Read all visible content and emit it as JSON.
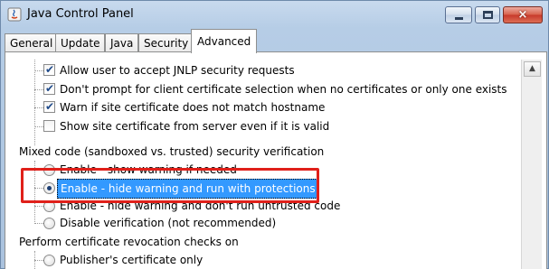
{
  "window": {
    "title": "Java Control Panel",
    "close_glyph": "×"
  },
  "tabs": [
    {
      "label": "General"
    },
    {
      "label": "Update"
    },
    {
      "label": "Java"
    },
    {
      "label": "Security"
    },
    {
      "label": "Advanced"
    }
  ],
  "checkbox_items": [
    {
      "label": "Allow user to accept JNLP security requests",
      "checked": true
    },
    {
      "label": "Don't prompt for client certificate selection when no certificates or only one exists",
      "checked": true
    },
    {
      "label": "Warn if site certificate does not match hostname",
      "checked": true
    },
    {
      "label": "Show site certificate from server even if it is valid",
      "checked": false
    }
  ],
  "mixed_code": {
    "heading": "Mixed code (sandboxed vs. trusted) security verification",
    "options": [
      {
        "label": "Enable - show warning if needed",
        "selected": false
      },
      {
        "label": "Enable - hide warning and run with protections",
        "selected": true
      },
      {
        "label": "Enable - hide warning and don't run untrusted code",
        "selected": false
      },
      {
        "label": "Disable verification (not recommended)",
        "selected": false
      }
    ]
  },
  "revocation": {
    "heading": "Perform certificate revocation checks on",
    "options": [
      {
        "label": "Publisher's certificate only",
        "selected": false
      }
    ]
  },
  "colors": {
    "selection": "#3399ff",
    "annotation_box": "#e0201a"
  }
}
